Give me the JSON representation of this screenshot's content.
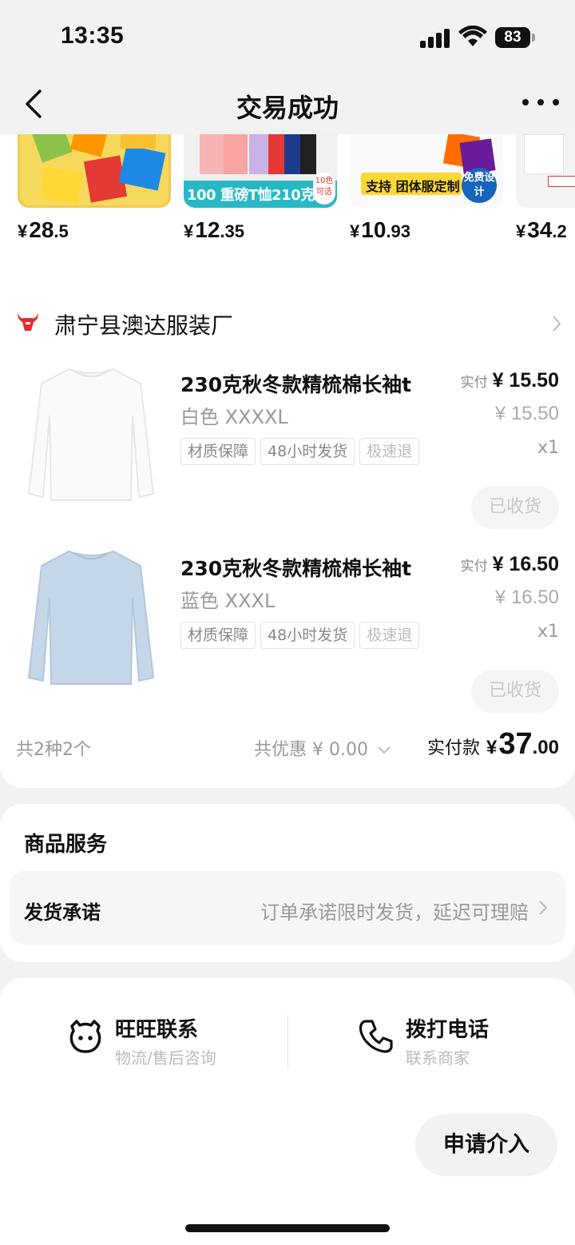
{
  "status": {
    "time": "13:35",
    "battery": "83"
  },
  "nav": {
    "title": "交易成功"
  },
  "recommendations": [
    {
      "price_int": "28",
      "price_dec": ".5",
      "banner": ""
    },
    {
      "price_int": "12",
      "price_dec": ".35",
      "banner": "100 重磅T恤210克"
    },
    {
      "price_int": "10",
      "price_dec": ".93",
      "banner": "支持 团体服定制"
    },
    {
      "price_int": "34",
      "price_dec": ".2",
      "banner": ""
    }
  ],
  "currency": "¥",
  "rec_badges": {
    "free_design": "免费设计",
    "colors": "10色可选"
  },
  "shop": {
    "name": "肃宁县澳达服装厂"
  },
  "items": [
    {
      "title": "230克秋冬款精梳棉长袖t",
      "spec": "白色 XXXXL",
      "tags": [
        "材质保障",
        "48小时发货",
        "极速退"
      ],
      "paid_label": "实付",
      "paid": "¥ 15.50",
      "orig": "¥ 15.50",
      "qty": "x1",
      "status": "已收货",
      "color": "#ffffff"
    },
    {
      "title": "230克秋冬款精梳棉长袖t",
      "spec": "蓝色 XXXL",
      "tags": [
        "材质保障",
        "48小时发货",
        "极速退"
      ],
      "paid_label": "实付",
      "paid": "¥ 16.50",
      "orig": "¥ 16.50",
      "qty": "x1",
      "status": "已收货",
      "color": "#c4d6e8"
    }
  ],
  "summary": {
    "count": "共2种2个",
    "discount": "共优惠 ¥ 0.00",
    "total_label": "实付款",
    "total_currency": "¥",
    "total_int": "37",
    "total_dec": ".00"
  },
  "services": {
    "title": "商品服务",
    "row_label": "发货承诺",
    "row_value": "订单承诺限时发货，延迟可理赔"
  },
  "contact": {
    "wangwang_title": "旺旺联系",
    "wangwang_sub": "物流/售后咨询",
    "phone_title": "拨打电话",
    "phone_sub": "联系商家",
    "intervene": "申请介入"
  },
  "colors": {
    "accent_red": "#e8282b",
    "text": "#111111",
    "muted": "#999999"
  }
}
